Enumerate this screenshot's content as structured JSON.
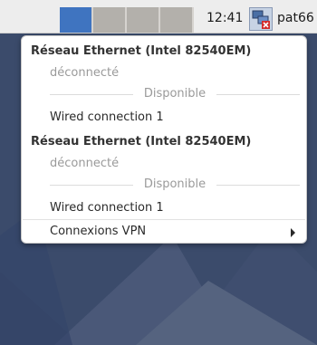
{
  "panel": {
    "workspaces": [
      "ws1",
      "ws2",
      "ws3",
      "ws4"
    ],
    "clock": "12:41",
    "username": "pat66",
    "network_icon": "network-disconnected-icon"
  },
  "menu": {
    "sections": [
      {
        "header": "Réseau Ethernet (Intel 82540EM)",
        "status": "déconnecté",
        "available_label": "Disponible",
        "connection": "Wired connection 1"
      },
      {
        "header": "Réseau Ethernet (Intel 82540EM)",
        "status": "déconnecté",
        "available_label": "Disponible",
        "connection": "Wired connection 1"
      }
    ],
    "vpn_label": "Connexions VPN"
  },
  "colors": {
    "panel_bg": "#ededed",
    "active_workspace": "#3f74c0",
    "inactive_workspace": "#b3b0ab",
    "desktop_bg": "#3a4a6a"
  }
}
